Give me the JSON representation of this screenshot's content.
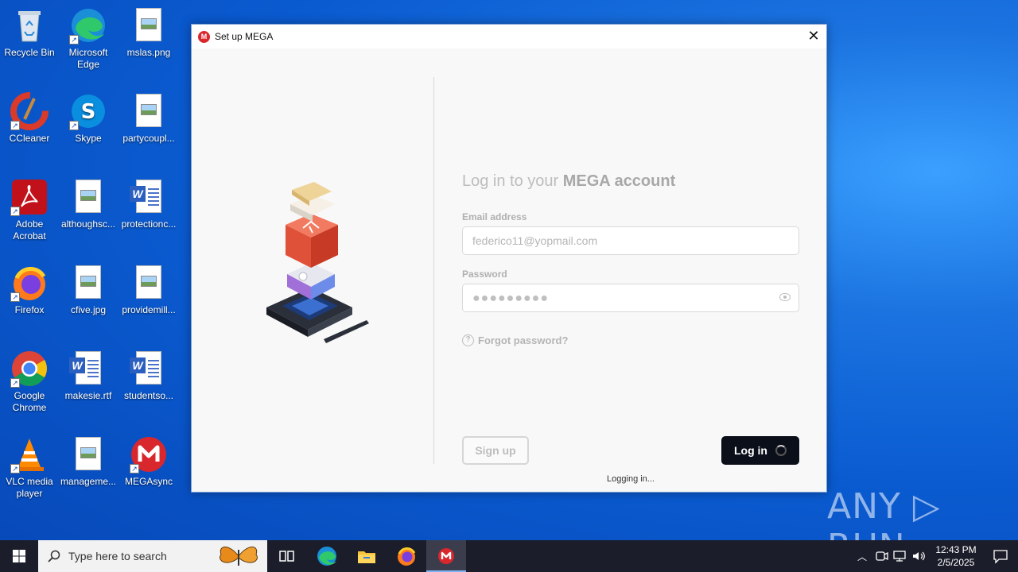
{
  "desktop": {
    "icons": [
      {
        "label": "Recycle Bin"
      },
      {
        "label": "Microsoft Edge"
      },
      {
        "label": "mslas.png"
      },
      {
        "label": "CCleaner"
      },
      {
        "label": "Skype"
      },
      {
        "label": "partycoupl..."
      },
      {
        "label": "Adobe Acrobat"
      },
      {
        "label": "althoughsc..."
      },
      {
        "label": "protectionc..."
      },
      {
        "label": "Firefox"
      },
      {
        "label": "cfive.jpg"
      },
      {
        "label": "providemill..."
      },
      {
        "label": "Google Chrome"
      },
      {
        "label": "makesie.rtf"
      },
      {
        "label": "studentso..."
      },
      {
        "label": "VLC media player"
      },
      {
        "label": "manageme..."
      },
      {
        "label": "MEGAsync"
      }
    ]
  },
  "window": {
    "title": "Set up MEGA",
    "close_glyph": "✕",
    "heading_prefix": "Log in to your ",
    "heading_brand": "MEGA account",
    "email_label": "Email address",
    "email_value": "federico11@yopmail.com",
    "password_label": "Password",
    "password_value": "●●●●●●●●●",
    "forgot_label": "Forgot password?",
    "signup_label": "Sign up",
    "login_label": "Log in",
    "status_text": "Logging in..."
  },
  "taskbar": {
    "search_placeholder": "Type here to search",
    "time": "12:43 PM",
    "date": "2/5/2025"
  },
  "watermark": "ANY ▷ RUN",
  "colors": {
    "mega_red": "#d9272e",
    "login_button": "#0b0f1a",
    "desktop_blue": "#0a5bd0"
  }
}
